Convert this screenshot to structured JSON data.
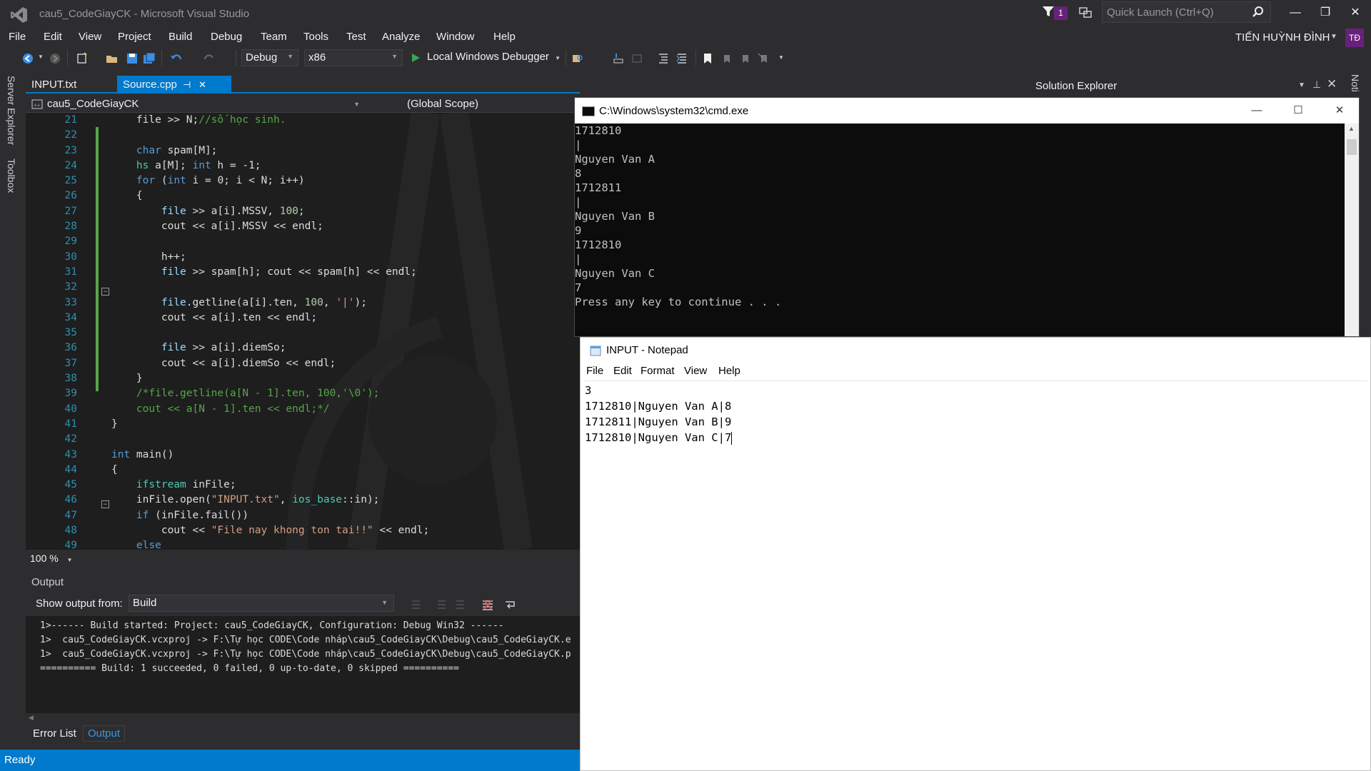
{
  "window": {
    "title": "cau5_CodeGiayCK - Microsoft Visual Studio",
    "notifications_count": "1",
    "quick_launch_placeholder": "Quick Launch (Ctrl+Q)",
    "user_name": "TIẾN HUỲNH ĐÌNH",
    "user_initials": "TĐ"
  },
  "menu": [
    "File",
    "Edit",
    "View",
    "Project",
    "Build",
    "Debug",
    "Team",
    "Tools",
    "Test",
    "Analyze",
    "Window",
    "Help"
  ],
  "toolbar": {
    "configuration": "Debug",
    "platform": "x86",
    "debugger_label": "Local Windows Debugger"
  },
  "side_tabs": [
    "Server Explorer",
    "Toolbox"
  ],
  "editor": {
    "tabs": [
      {
        "label": "INPUT.txt",
        "active": false
      },
      {
        "label": "Source.cpp",
        "active": true
      }
    ],
    "project_dropdown": "cau5_CodeGiayCK",
    "scope_dropdown": "(Global Scope)",
    "zoom": "100 %",
    "line_numbers": [
      "21",
      "22",
      "23",
      "24",
      "25",
      "26",
      "27",
      "28",
      "29",
      "30",
      "31",
      "32",
      "33",
      "34",
      "35",
      "36",
      "37",
      "38",
      "39",
      "40",
      "41",
      "42",
      "43",
      "44",
      "45",
      "46",
      "47",
      "48",
      "49"
    ],
    "code_lines": [
      [
        [
          "    file >> N;",
          "#dcdcdc"
        ],
        [
          "//số học sinh.",
          "#57a64a"
        ]
      ],
      [],
      [
        [
          "    ",
          "#dcdcdc"
        ],
        [
          "char",
          "#569cd6"
        ],
        [
          " spam[M];",
          "#dcdcdc"
        ]
      ],
      [
        [
          "    ",
          "#dcdcdc"
        ],
        [
          "hs",
          "#4ec9b0"
        ],
        [
          " a[M]; ",
          "#dcdcdc"
        ],
        [
          "int",
          "#569cd6"
        ],
        [
          " h = -1;",
          "#dcdcdc"
        ]
      ],
      [
        [
          "    ",
          "#dcdcdc"
        ],
        [
          "for",
          "#569cd6"
        ],
        [
          " (",
          "#dcdcdc"
        ],
        [
          "int",
          "#569cd6"
        ],
        [
          " i = 0; i < N; i++)",
          "#dcdcdc"
        ]
      ],
      [
        [
          "    {",
          "#dcdcdc"
        ]
      ],
      [
        [
          "        ",
          "#dcdcdc"
        ],
        [
          "file",
          "#9cdcfe"
        ],
        [
          " >> a[i].MSSV, ",
          "#dcdcdc"
        ],
        [
          "100",
          "#b5cea8"
        ],
        [
          ";",
          "#dcdcdc"
        ]
      ],
      [
        [
          "        cout << a[i].MSSV << endl;",
          "#dcdcdc"
        ]
      ],
      [],
      [
        [
          "        h++;",
          "#dcdcdc"
        ]
      ],
      [
        [
          "        ",
          "#dcdcdc"
        ],
        [
          "file",
          "#9cdcfe"
        ],
        [
          " >> spam[h]; cout << spam[h] << endl;",
          "#dcdcdc"
        ]
      ],
      [],
      [
        [
          "        ",
          "#dcdcdc"
        ],
        [
          "file",
          "#9cdcfe"
        ],
        [
          ".getline(a[i].ten, ",
          "#dcdcdc"
        ],
        [
          "100",
          "#b5cea8"
        ],
        [
          ", ",
          "#dcdcdc"
        ],
        [
          "'|'",
          "#d69d85"
        ],
        [
          ");",
          "#dcdcdc"
        ]
      ],
      [
        [
          "        cout << a[i].ten << endl;",
          "#dcdcdc"
        ]
      ],
      [],
      [
        [
          "        ",
          "#dcdcdc"
        ],
        [
          "file",
          "#9cdcfe"
        ],
        [
          " >> a[i].diemSo;",
          "#dcdcdc"
        ]
      ],
      [
        [
          "        cout << a[i].diemSo << endl;",
          "#dcdcdc"
        ]
      ],
      [
        [
          "    }",
          "#dcdcdc"
        ]
      ],
      [
        [
          "    /*file.getline(a[N - 1].ten, 100,'\\0');",
          "#57a64a"
        ]
      ],
      [
        [
          "    cout << a[N - 1].ten << endl;*/",
          "#57a64a"
        ]
      ],
      [
        [
          "}",
          "#dcdcdc"
        ]
      ],
      [],
      [
        [
          "int",
          "#569cd6"
        ],
        [
          " main()",
          "#dcdcdc"
        ]
      ],
      [
        [
          "{",
          "#dcdcdc"
        ]
      ],
      [
        [
          "    ",
          "#dcdcdc"
        ],
        [
          "ifstream",
          "#4ec9b0"
        ],
        [
          " inFile;",
          "#dcdcdc"
        ]
      ],
      [
        [
          "    inFile.open(",
          "#dcdcdc"
        ],
        [
          "\"INPUT.txt\"",
          "#d69d85"
        ],
        [
          ", ",
          "#dcdcdc"
        ],
        [
          "ios_base",
          "#4ec9b0"
        ],
        [
          "::in);",
          "#dcdcdc"
        ]
      ],
      [
        [
          "    ",
          "#dcdcdc"
        ],
        [
          "if",
          "#569cd6"
        ],
        [
          " (inFile.fail())",
          "#dcdcdc"
        ]
      ],
      [
        [
          "        cout << ",
          "#dcdcdc"
        ],
        [
          "\"File nay khong ton tai!!\"",
          "#d69d85"
        ],
        [
          " << endl;",
          "#dcdcdc"
        ]
      ],
      [
        [
          "    ",
          "#dcdcdc"
        ],
        [
          "else",
          "#569cd6"
        ]
      ]
    ]
  },
  "output": {
    "title": "Output",
    "show_from_label": "Show output from:",
    "source": "Build",
    "lines": [
      "1>------ Build started: Project: cau5_CodeGiayCK, Configuration: Debug Win32 ------",
      "1>  cau5_CodeGiayCK.vcxproj -> F:\\Tự học CODE\\Code nháp\\cau5_CodeGiayCK\\Debug\\cau5_CodeGiayCK.e",
      "1>  cau5_CodeGiayCK.vcxproj -> F:\\Tự học CODE\\Code nháp\\cau5_CodeGiayCK\\Debug\\cau5_CodeGiayCK.p",
      "========== Build: 1 succeeded, 0 failed, 0 up-to-date, 0 skipped =========="
    ],
    "bottom_tabs": [
      "Error List",
      "Output"
    ]
  },
  "status": "Ready",
  "solution_explorer": {
    "title": "Solution Explorer",
    "right_tab": "Noti"
  },
  "cmd": {
    "title": "C:\\Windows\\system32\\cmd.exe",
    "lines": [
      "1712810",
      "|",
      "Nguyen Van A",
      "8",
      "1712811",
      "|",
      "Nguyen Van B",
      "9",
      "1712810",
      "|",
      "Nguyen Van C",
      "7",
      "Press any key to continue . . ."
    ]
  },
  "notepad": {
    "title": "INPUT - Notepad",
    "menu": [
      "File",
      "Edit",
      "Format",
      "View",
      "Help"
    ],
    "lines": [
      "3",
      "1712810|Nguyen Van A|8",
      "1712811|Nguyen Van B|9",
      "1712810|Nguyen Van C|7"
    ]
  },
  "colors": {
    "accent": "#007acc",
    "vs_purple": "#68217a",
    "editor_bg": "#1e1e1e",
    "chrome_bg": "#2d2d30"
  }
}
